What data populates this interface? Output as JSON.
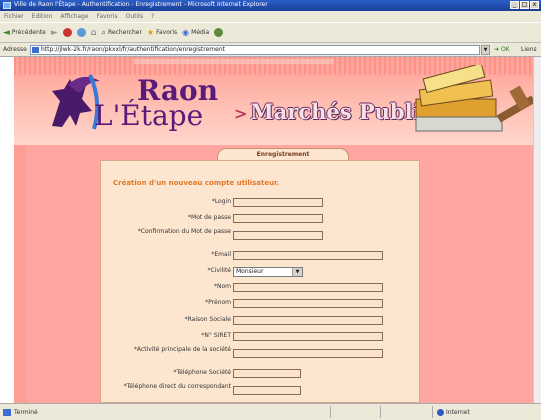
{
  "window": {
    "title": "Ville de Raon l'Étape - Authentification - Enregistrement - Microsoft Internet Explorer"
  },
  "menu": [
    "Fichier",
    "Edition",
    "Affichage",
    "Favoris",
    "Outils",
    "?"
  ],
  "toolbar": {
    "back": "Précédente",
    "search": "Rechercher",
    "favorites": "Favoris",
    "media": "Média"
  },
  "address": {
    "label": "Adresse",
    "url": "http://jlwk-2k.fr/raon/pkxxl/fr/authentification/enregistrement",
    "go": "OK",
    "links": "Liens"
  },
  "banner": {
    "logo_line1": "Raon",
    "logo_line2": "L'Étape",
    "section": "Marchés Publics"
  },
  "tab_label": "Enregistrement",
  "form": {
    "title": "Création d'un nouveau compte utilisateur.",
    "fields": [
      {
        "label": "*Login"
      },
      {
        "label": "*Mot de passe"
      },
      {
        "label": "*Confirmation du Mot de passe"
      },
      {
        "label": "*Email"
      },
      {
        "label": "*Civilité",
        "value": "Monsieur"
      },
      {
        "label": "*Nom"
      },
      {
        "label": "*Prénom"
      },
      {
        "label": "*Raison Sociale"
      },
      {
        "label": "*N° SIRET"
      },
      {
        "label": "*Activité principale de la société"
      },
      {
        "label": "*Téléphone Société"
      },
      {
        "label": "*Téléphone direct du correspondant"
      }
    ]
  },
  "status": {
    "left": "Terminé",
    "zone": "Internet"
  }
}
